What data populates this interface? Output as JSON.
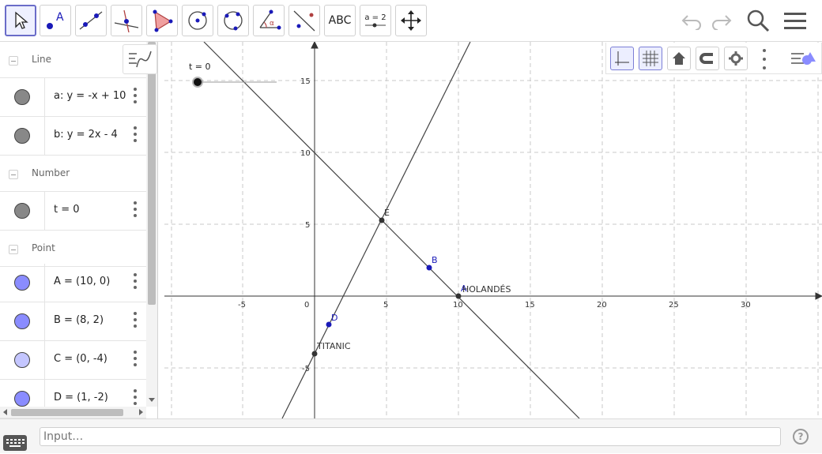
{
  "toolbar": {
    "tools": [
      {
        "name": "move-tool",
        "label": ""
      },
      {
        "name": "point-tool",
        "label": "A"
      },
      {
        "name": "line-tool",
        "label": ""
      },
      {
        "name": "perpendicular-line-tool",
        "label": ""
      },
      {
        "name": "polygon-tool",
        "label": ""
      },
      {
        "name": "circle-center-point-tool",
        "label": ""
      },
      {
        "name": "circle-three-points-tool",
        "label": ""
      },
      {
        "name": "angle-tool",
        "label": "α"
      },
      {
        "name": "reflect-tool",
        "label": ""
      },
      {
        "name": "text-tool",
        "label": "ABC"
      },
      {
        "name": "slider-tool",
        "label": "a = 2"
      },
      {
        "name": "move-graphics-tool",
        "label": ""
      }
    ],
    "active_tool": "move-tool"
  },
  "algebra": {
    "groups": [
      {
        "title": "Line",
        "items": [
          {
            "expr": "a: y = -x + 10",
            "color": "#888888"
          },
          {
            "expr": "b: y = 2x - 4",
            "color": "#888888"
          }
        ]
      },
      {
        "title": "Number",
        "items": [
          {
            "expr": "t = 0",
            "color": "#888888"
          }
        ]
      },
      {
        "title": "Point",
        "items": [
          {
            "expr": "A = (10, 0)",
            "color": "#8a8cff"
          },
          {
            "expr": "B = (8, 2)",
            "color": "#8a8cff"
          },
          {
            "expr": "C = (0, -4)",
            "color": "#c4c6ff"
          },
          {
            "expr": "D = (1, -2)",
            "color": "#8a8cff"
          }
        ]
      }
    ]
  },
  "graphics": {
    "slider_label": "t = 0",
    "x_ticks": [
      "-5",
      "0",
      "5",
      "10",
      "15",
      "20",
      "25",
      "30"
    ],
    "y_ticks": [
      "15",
      "10",
      "5",
      "-5"
    ],
    "point_labels": {
      "E": "E",
      "B": "B",
      "A": "A",
      "D": "D",
      "titanic": "TITANIC",
      "holandes": "HOLANDÉS"
    },
    "colors": {
      "grid": "#c8c8c8",
      "axis": "#333333",
      "line": "#444444",
      "point_blue": "#1a1ab8",
      "point_dark": "#333333"
    }
  },
  "input": {
    "placeholder": "Input…"
  },
  "help": "?"
}
